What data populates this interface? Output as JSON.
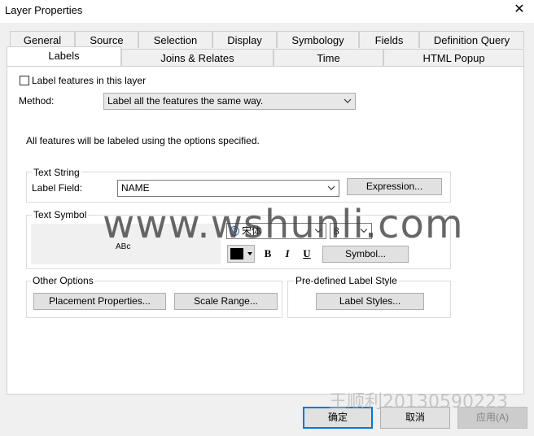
{
  "window": {
    "title": "Layer Properties"
  },
  "tabs_row1": [
    "General",
    "Source",
    "Selection",
    "Display",
    "Symbology",
    "Fields",
    "Definition Query"
  ],
  "tabs_row2": [
    "Labels",
    "Joins & Relates",
    "Time",
    "HTML Popup"
  ],
  "label_features": {
    "label": "Label features in this layer",
    "checked": false
  },
  "method": {
    "label": "Method:",
    "value": "Label all the features the same way."
  },
  "info_text": "All features will be labeled using the options specified.",
  "text_string": {
    "group_title": "Text String",
    "label_field_label": "Label Field:",
    "label_field_value": "NAME",
    "expression_button": "Expression..."
  },
  "text_symbol": {
    "group_title": "Text Symbol",
    "preview_text": "ABc",
    "font_name": "宋体",
    "font_size": "8",
    "color": "#000000",
    "bold_label": "B",
    "italic_label": "I",
    "underline_label": "U",
    "symbol_button": "Symbol..."
  },
  "other_options": {
    "group_title": "Other Options",
    "placement_button": "Placement Properties...",
    "scale_button": "Scale Range..."
  },
  "predefined": {
    "group_title": "Pre-defined Label Style",
    "label_styles_button": "Label Styles..."
  },
  "footer": {
    "ok": "确定",
    "cancel": "取消",
    "apply": "应用(A)"
  },
  "watermarks": {
    "main": "www.wshunli.com",
    "corner": "王顺利20130590223"
  }
}
